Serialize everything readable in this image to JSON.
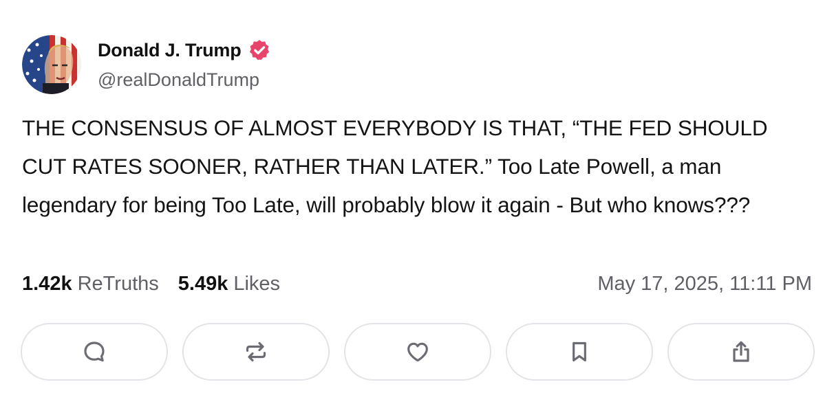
{
  "author": {
    "name": "Donald J. Trump",
    "handle": "@realDonaldTrump",
    "verified": true,
    "avatar_icon": "flag-portrait-avatar"
  },
  "post": {
    "text": "THE CONSENSUS OF ALMOST EVERYBODY IS THAT, “THE FED SHOULD CUT RATES SOONER, RATHER THAN LATER.” Too Late Powell, a man legendary for being Too Late, will probably blow it again - But who knows???"
  },
  "stats": {
    "retruths_count": "1.42k",
    "retruths_label": "ReTruths",
    "likes_count": "5.49k",
    "likes_label": "Likes"
  },
  "timestamp": "May 17, 2025, 11:11 PM",
  "actions": [
    {
      "icon": "reply-icon"
    },
    {
      "icon": "retruth-icon"
    },
    {
      "icon": "like-heart-icon"
    },
    {
      "icon": "bookmark-icon"
    },
    {
      "icon": "share-icon"
    }
  ],
  "colors": {
    "verified_badge": "#e8436b",
    "secondary_text": "#5f5f66",
    "button_border": "#e4e4e8",
    "icon_stroke": "#6b6b73"
  }
}
